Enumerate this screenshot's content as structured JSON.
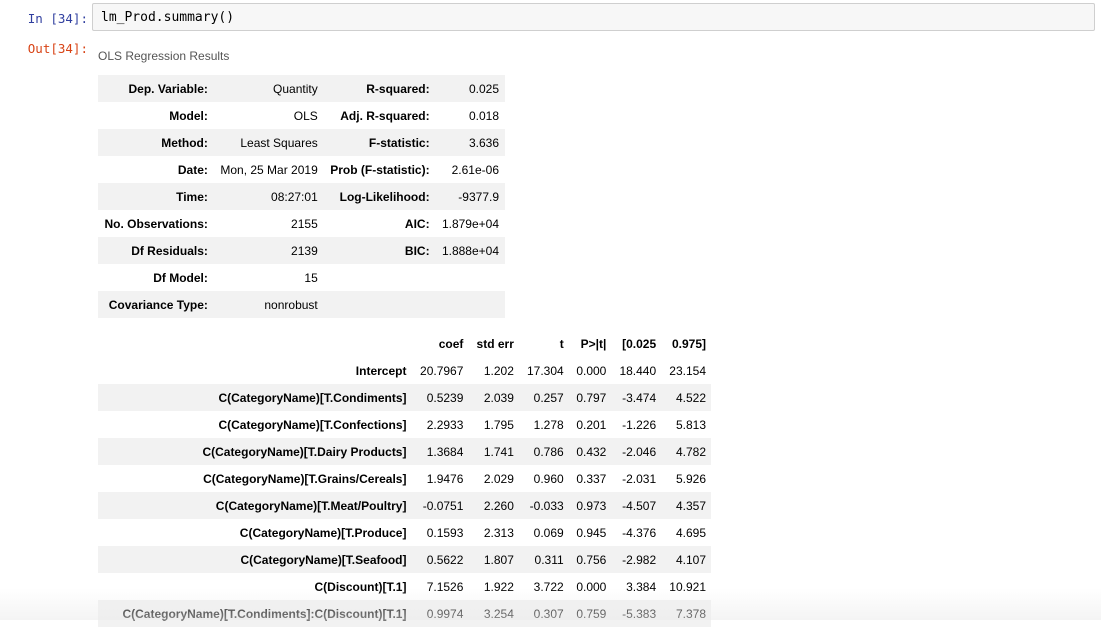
{
  "cell": {
    "in_prompt": "In [34]:",
    "out_prompt": "Out[34]:",
    "code": "lm_Prod.summary()"
  },
  "caption": "OLS Regression Results",
  "summary_rows": [
    {
      "l1": "Dep. Variable:",
      "v1": "Quantity",
      "l2": "R-squared:",
      "v2": "0.025"
    },
    {
      "l1": "Model:",
      "v1": "OLS",
      "l2": "Adj. R-squared:",
      "v2": "0.018"
    },
    {
      "l1": "Method:",
      "v1": "Least Squares",
      "l2": "F-statistic:",
      "v2": "3.636"
    },
    {
      "l1": "Date:",
      "v1": "Mon, 25 Mar 2019",
      "l2": "Prob (F-statistic):",
      "v2": "2.61e-06"
    },
    {
      "l1": "Time:",
      "v1": "08:27:01",
      "l2": "Log-Likelihood:",
      "v2": "-9377.9"
    },
    {
      "l1": "No. Observations:",
      "v1": "2155",
      "l2": "AIC:",
      "v2": "1.879e+04"
    },
    {
      "l1": "Df Residuals:",
      "v1": "2139",
      "l2": "BIC:",
      "v2": "1.888e+04"
    },
    {
      "l1": "Df Model:",
      "v1": "15",
      "l2": "",
      "v2": ""
    },
    {
      "l1": "Covariance Type:",
      "v1": "nonrobust",
      "l2": "",
      "v2": ""
    }
  ],
  "coef_headers": [
    "",
    "coef",
    "std err",
    "t",
    "P>|t|",
    "[0.025",
    "0.975]"
  ],
  "coef_rows": [
    [
      "Intercept",
      "20.7967",
      "1.202",
      "17.304",
      "0.000",
      "18.440",
      "23.154"
    ],
    [
      "C(CategoryName)[T.Condiments]",
      "0.5239",
      "2.039",
      "0.257",
      "0.797",
      "-3.474",
      "4.522"
    ],
    [
      "C(CategoryName)[T.Confections]",
      "2.2933",
      "1.795",
      "1.278",
      "0.201",
      "-1.226",
      "5.813"
    ],
    [
      "C(CategoryName)[T.Dairy Products]",
      "1.3684",
      "1.741",
      "0.786",
      "0.432",
      "-2.046",
      "4.782"
    ],
    [
      "C(CategoryName)[T.Grains/Cereals]",
      "1.9476",
      "2.029",
      "0.960",
      "0.337",
      "-2.031",
      "5.926"
    ],
    [
      "C(CategoryName)[T.Meat/Poultry]",
      "-0.0751",
      "2.260",
      "-0.033",
      "0.973",
      "-4.507",
      "4.357"
    ],
    [
      "C(CategoryName)[T.Produce]",
      "0.1593",
      "2.313",
      "0.069",
      "0.945",
      "-4.376",
      "4.695"
    ],
    [
      "C(CategoryName)[T.Seafood]",
      "0.5622",
      "1.807",
      "0.311",
      "0.756",
      "-2.982",
      "4.107"
    ],
    [
      "C(Discount)[T.1]",
      "7.1526",
      "1.922",
      "3.722",
      "0.000",
      "3.384",
      "10.921"
    ],
    [
      "C(CategoryName)[T.Condiments]:C(Discount)[T.1]",
      "0.9974",
      "3.254",
      "0.307",
      "0.759",
      "-5.383",
      "7.378"
    ]
  ]
}
